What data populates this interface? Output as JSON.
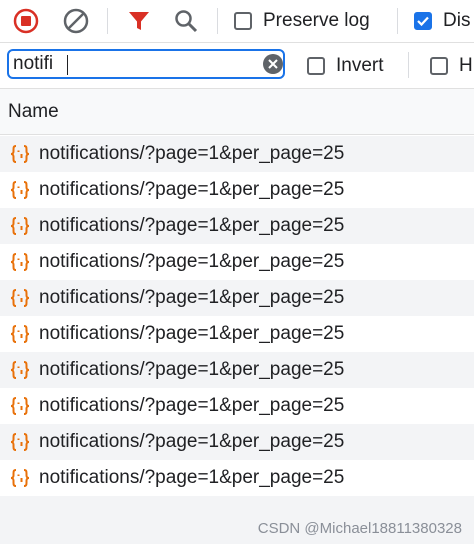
{
  "toolbar": {
    "record_icon": "record-stop-icon",
    "clear_icon": "clear-circle-icon",
    "filter_icon": "filter-funnel-icon",
    "search_icon": "search-icon",
    "preserve_log_label": "Preserve log",
    "preserve_log_checked": false,
    "disable_cache_label": "Dis",
    "disable_cache_checked": true,
    "accent_color": "#d93025",
    "checkbox_color": "#1a73e8"
  },
  "filter": {
    "value": "notifi",
    "invert_label": "Invert",
    "invert_checked": false,
    "hide_label": "H",
    "hide_checked": false
  },
  "table": {
    "header_name": "Name",
    "row_icon": "xhr-braces-icon",
    "rows": [
      {
        "name": "notifications/?page=1&per_page=25"
      },
      {
        "name": "notifications/?page=1&per_page=25"
      },
      {
        "name": "notifications/?page=1&per_page=25"
      },
      {
        "name": "notifications/?page=1&per_page=25"
      },
      {
        "name": "notifications/?page=1&per_page=25"
      },
      {
        "name": "notifications/?page=1&per_page=25"
      },
      {
        "name": "notifications/?page=1&per_page=25"
      },
      {
        "name": "notifications/?page=1&per_page=25"
      },
      {
        "name": "notifications/?page=1&per_page=25"
      },
      {
        "name": "notifications/?page=1&per_page=25"
      }
    ]
  },
  "watermark": "CSDN @Michael18811380328"
}
